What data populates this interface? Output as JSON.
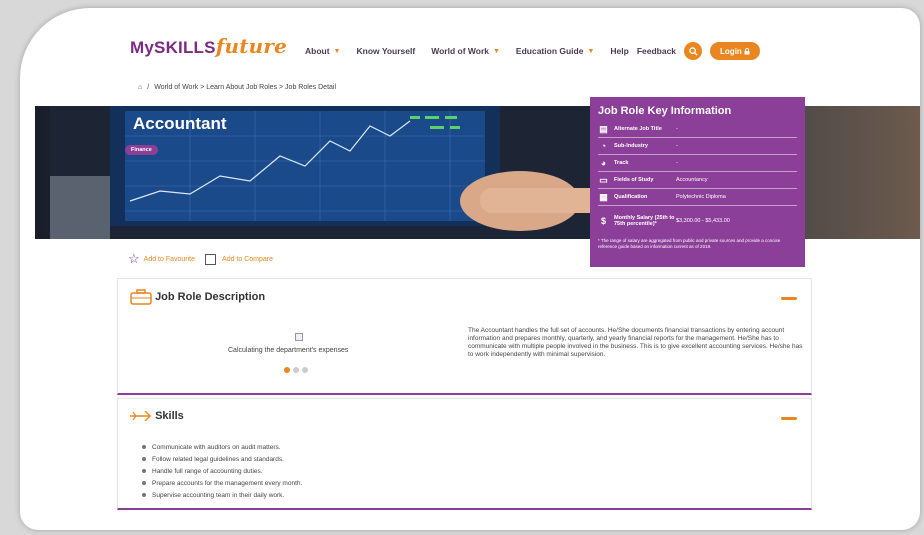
{
  "header": {
    "logo_my": "My",
    "logo_skills": "SKILLS",
    "logo_future": "future",
    "nav": [
      {
        "label": "About",
        "dropdown": true
      },
      {
        "label": "Know Yourself",
        "dropdown": false
      },
      {
        "label": "World of Work",
        "dropdown": true
      },
      {
        "label": "Education Guide",
        "dropdown": true
      },
      {
        "label": "Help",
        "dropdown": false
      },
      {
        "label": "Feedback",
        "dropdown": false
      }
    ],
    "login_label": "Login",
    "accent": "#e9861f",
    "brand": "#7b2b83"
  },
  "breadcrumb": {
    "home_icon": "home-icon",
    "sep": "/",
    "path": "World of Work > Learn About Job Roles > Job Roles Detail"
  },
  "hero": {
    "title": "Accountant",
    "tag": "Finance"
  },
  "key_info": {
    "title": "Job Role Key Information",
    "rows": [
      {
        "icon": "briefcase-icon",
        "label": "Alternate Job Title",
        "value": "-"
      },
      {
        "icon": "pie-icon",
        "label": "Sub-Industry",
        "value": "-"
      },
      {
        "icon": "track-icon",
        "label": "Track",
        "value": "-"
      },
      {
        "icon": "book-icon",
        "label": "Fields of Study",
        "value": "Accountancy"
      },
      {
        "icon": "certificate-icon",
        "label": "Qualification",
        "value": "Polytechnic Diploma"
      },
      {
        "icon": "dollar-icon",
        "label": "Monthly Salary (25th to 75th percentile)*",
        "value": "$3,300.00 - $5,433.00"
      }
    ],
    "note": "* The range of salary are aggregated from public and private sources and provide a concise reference guide based on information current as of 2019.",
    "color": "#8c3f98"
  },
  "actions": {
    "favourite": "Add to Favourite",
    "compare": "Add to Compare"
  },
  "description": {
    "title": "Job Role Description",
    "image_caption": "Calculating the department's expenses",
    "text": "The Accountant handles the full set of accounts. He/She documents financial transactions by entering account information and prepares monthly, quarterly, and yearly financial reports for the management. He/She has to communicate with multiple people involved in the business. This is to give excellent accounting services. He/she has to work independently with minimal supervision."
  },
  "skills": {
    "title": "Skills",
    "items": [
      "Communicate with auditors on audit matters.",
      "Follow related legal guidelines and standards.",
      "Handle full range of accounting duties.",
      "Prepare accounts for the management every month.",
      "Supervise accounting team in their daily work."
    ]
  }
}
